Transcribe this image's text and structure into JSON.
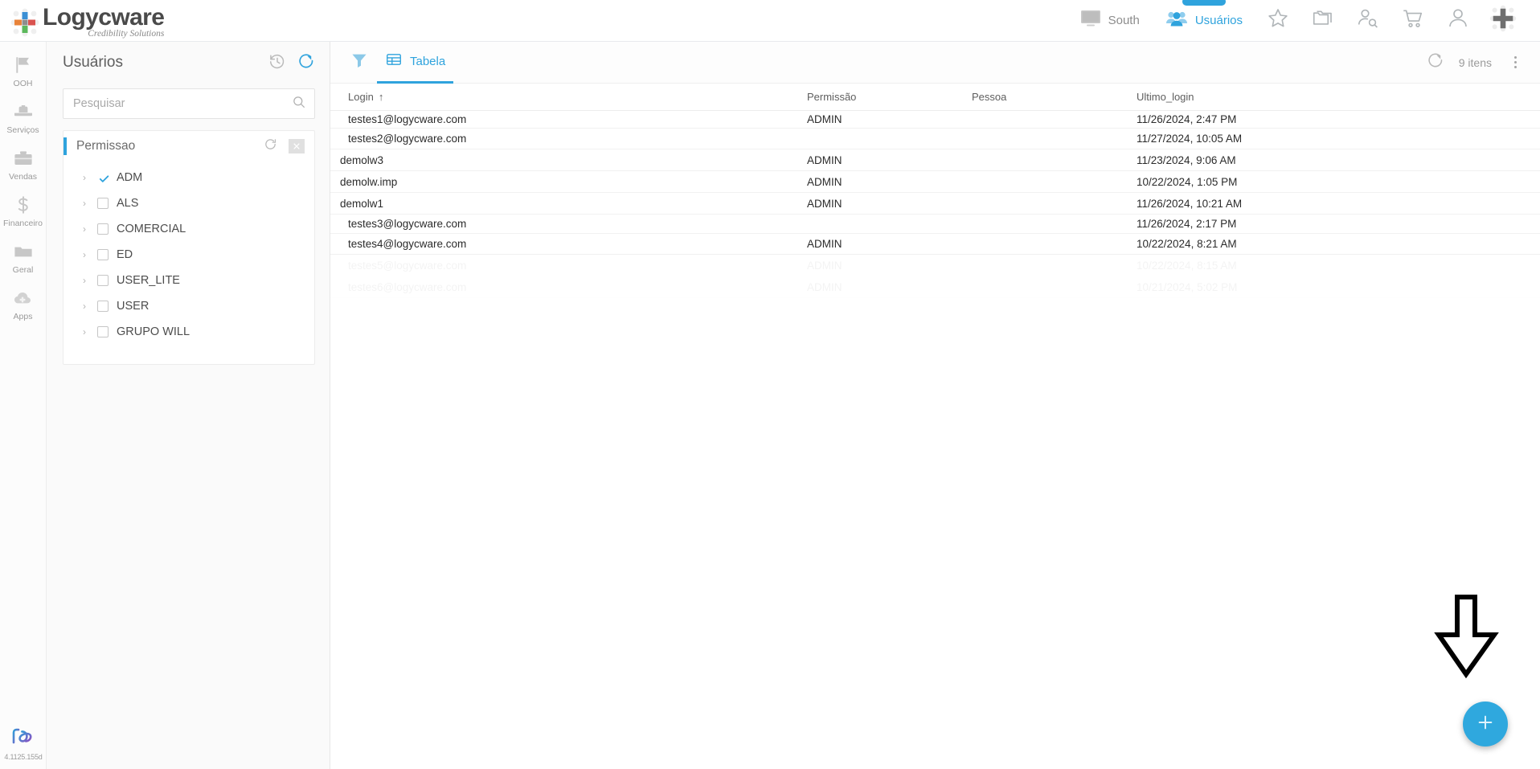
{
  "brand": {
    "name": "Logycware",
    "tagline": "Credibility Solutions",
    "logo_colors": [
      "#e8833a",
      "#3b8fd4",
      "#5cb85c",
      "#d9534f"
    ]
  },
  "topbar": {
    "context_items": [
      {
        "label": "South",
        "icon": "monitor-icon",
        "active": false
      },
      {
        "label": "Usuários",
        "icon": "users-icon",
        "active": true
      }
    ],
    "actions": [
      {
        "name": "favorites-button",
        "icon": "star-icon"
      },
      {
        "name": "folders-button",
        "icon": "folders-icon"
      },
      {
        "name": "user-search-button",
        "icon": "user-search-icon"
      },
      {
        "name": "cart-button",
        "icon": "cart-icon"
      },
      {
        "name": "account-button",
        "icon": "user-icon"
      },
      {
        "name": "add-button",
        "icon": "plus-cross-icon"
      }
    ]
  },
  "rail": {
    "items": [
      {
        "label": "OOH",
        "icon": "flag-icon"
      },
      {
        "label": "Serviços",
        "icon": "hardhat-icon"
      },
      {
        "label": "Vendas",
        "icon": "briefcase-icon"
      },
      {
        "label": "Financeiro",
        "icon": "dollar-icon"
      },
      {
        "label": "Geral",
        "icon": "folder-icon"
      },
      {
        "label": "Apps",
        "icon": "cloud-plus-icon"
      }
    ],
    "footer": {
      "logo": "fx-logo-icon",
      "version": "4.1125.155d"
    }
  },
  "left_panel": {
    "title": "Usuários",
    "history_icon": "history-icon",
    "refresh_icon": "refresh-icon",
    "search": {
      "placeholder": "Pesquisar",
      "value": "",
      "icon": "search-icon"
    },
    "facet": {
      "title": "Permissao",
      "refresh_icon": "refresh-icon",
      "close_icon": "close-icon",
      "items": [
        {
          "label": "ADM",
          "checked": true
        },
        {
          "label": "ALS",
          "checked": false
        },
        {
          "label": "COMERCIAL",
          "checked": false
        },
        {
          "label": "ED",
          "checked": false
        },
        {
          "label": "USER_LITE",
          "checked": false
        },
        {
          "label": "USER",
          "checked": false
        },
        {
          "label": "GRUPO WILL",
          "checked": false
        }
      ]
    }
  },
  "main": {
    "toolbar": {
      "filter_icon": "filter-funnel-icon",
      "tab_label": "Tabela",
      "tab_icon": "table-icon",
      "refresh_icon": "refresh-icon",
      "count_label": "9 itens",
      "menu_icon": "kebab-menu-icon"
    },
    "table": {
      "columns": [
        {
          "key": "login",
          "label": "Login",
          "sorted": true,
          "sort_dir": "↑"
        },
        {
          "key": "permissao",
          "label": "Permissão",
          "sorted": false
        },
        {
          "key": "pessoa",
          "label": "Pessoa",
          "sorted": false
        },
        {
          "key": "ultimo_login",
          "label": "Ultimo_login",
          "sorted": false
        }
      ],
      "rows": [
        {
          "login": "testes1@logycware.com",
          "permissao": "ADMIN",
          "pessoa": "",
          "ultimo_login": "11/26/2024, 2:47 PM"
        },
        {
          "login": "testes2@logycware.com",
          "permissao": "",
          "pessoa": "",
          "ultimo_login": "11/27/2024, 10:05 AM"
        },
        {
          "login": "demolw3",
          "permissao": "ADMIN",
          "pessoa": "",
          "ultimo_login": "11/23/2024, 9:06 AM"
        },
        {
          "login": "demolw.imp",
          "permissao": "ADMIN",
          "pessoa": "",
          "ultimo_login": "10/22/2024, 1:05 PM"
        },
        {
          "login": "demolw1",
          "permissao": "ADMIN",
          "pessoa": "",
          "ultimo_login": "11/26/2024, 10:21 AM"
        },
        {
          "login": "testes3@logycware.com",
          "permissao": "",
          "pessoa": "",
          "ultimo_login": "11/26/2024, 2:17 PM"
        },
        {
          "login": "testes4@logycware.com",
          "permissao": "ADMIN",
          "pessoa": "",
          "ultimo_login": "10/22/2024, 8:21 AM"
        },
        {
          "login": "testes5@logycware.com",
          "permissao": "ADMIN",
          "pessoa": "",
          "ultimo_login": "10/22/2024, 8:15 AM",
          "ghost": true
        },
        {
          "login": "testes6@logycware.com",
          "permissao": "ADMIN",
          "pessoa": "",
          "ultimo_login": "10/21/2024, 5:02 PM",
          "ghost": true
        }
      ]
    },
    "fab": {
      "icon": "plus-icon",
      "color": "#2fa8de"
    },
    "annotation": {
      "icon": "down-arrow-annotation"
    }
  },
  "colors": {
    "accent": "#2fa3dd",
    "fab": "#2fa8de",
    "text": "#2b2b2b",
    "muted": "#9a9a9a"
  }
}
